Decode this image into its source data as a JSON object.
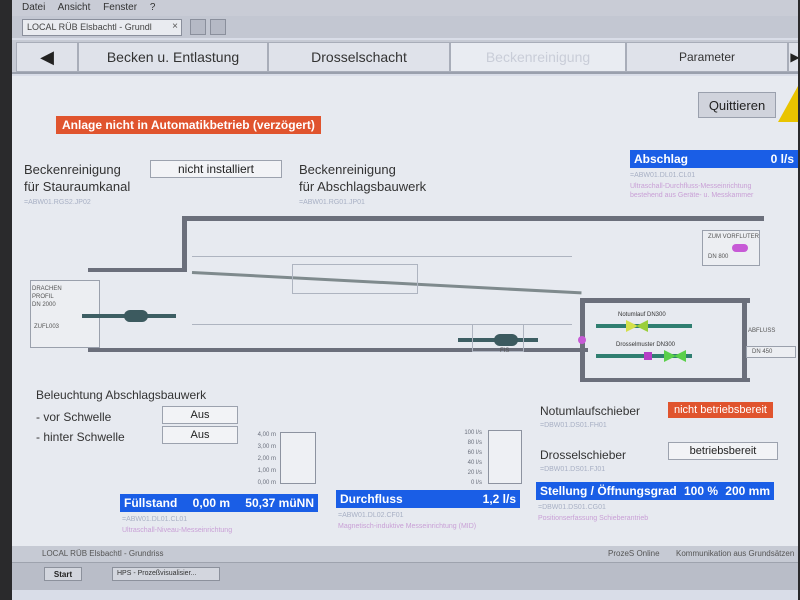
{
  "menu": {
    "items": [
      "Datei",
      "Ansicht",
      "Fenster",
      "?"
    ]
  },
  "document_tab": {
    "label": "LOCAL RÜB Elsbachtl - Grundl",
    "close": "×"
  },
  "nav": {
    "back_arrow": "◀",
    "forward_arrow": "▶",
    "tabs": [
      "Becken u. Entlastung",
      "Drosselschacht",
      "Beckenreinigung",
      "Parameter"
    ],
    "active_tab": "Beckenreinigung"
  },
  "toolbar": {
    "quittieren": "Quittieren"
  },
  "alarm": {
    "automatik": "Anlage nicht in Automatikbetrieb (verzögert)"
  },
  "beckenreinigung_stauraum": {
    "line1": "Beckenreinigung",
    "line2": "für Stauraumkanal",
    "status": "nicht installiert",
    "tag": "=ABW01.RGS2.JP02"
  },
  "beckenreinigung_abschlag": {
    "line1": "Beckenreinigung",
    "line2": "für Abschlagsbauwerk",
    "tag": "=ABW01.RG01.JP01"
  },
  "abschlag": {
    "label": "Abschlag",
    "value": "0 l/s",
    "tag": "=ABW01.DL01.CL01",
    "desc1": "Ultraschall-Durchfluss-Messeinrichtung",
    "desc2": "bestehend aus Geräte- u. Messkammer"
  },
  "diagram": {
    "zum_vorfluter": "ZUM VORFLUTER",
    "dn_vorfluter": "DN 800",
    "ablauf": "ABFLUSS",
    "dn_ablauf": "DN 450",
    "zulauf_line1": "DRACHEN",
    "zulauf_line2": "PROFIL",
    "zulauf_dn": "DN 2000",
    "zulauf_tag": "ZUFL003",
    "notumlauf_small": "Notumlauf DN300",
    "drossel_small": "Drosselmuster DN300",
    "fis": "FIS"
  },
  "beleuchtung": {
    "title": "Beleuchtung Abschlagsbauwerk",
    "vor_label": "- vor Schwelle",
    "vor_value": "Aus",
    "hinter_label": "- hinter Schwelle",
    "hinter_value": "Aus"
  },
  "level_scale": [
    "4,00 m",
    "3,00 m",
    "2,00 m",
    "1,00 m",
    "0,00 m"
  ],
  "flow_scale": [
    "100 l/s",
    "80 l/s",
    "60 l/s",
    "40 l/s",
    "20 l/s",
    "0 l/s"
  ],
  "fuellstand": {
    "label": "Füllstand",
    "value_m": "0,00 m",
    "value_nn": "50,37 müNN",
    "tag": "=ABW01.DL01.CL01",
    "desc": "Ultraschall-Niveau-Messeinrichtung"
  },
  "durchfluss": {
    "label": "Durchfluss",
    "value": "1,2 l/s",
    "tag": "=ABW01.DL02.CF01",
    "desc": "Magnetisch-induktive Messeinrichtung (MID)"
  },
  "notumlauf": {
    "label": "Notumlaufschieber",
    "status": "nicht betriebsbereit",
    "tag": "=DBW01.DS01.FH01"
  },
  "drosselschieber": {
    "label": "Drosselschieber",
    "status": "betriebsbereit",
    "tag": "=DBW01.DS01.FJ01"
  },
  "stellung": {
    "label": "Stellung / Öffnungsgrad",
    "percent": "100 %",
    "mm": "200 mm",
    "tag": "=DBW01.DS01.CG01",
    "desc": "Positionserfassung Schieberantrieb"
  },
  "statusbar": {
    "left": "LOCAL RÜB Elsbachtl - Grundriss",
    "prozess": "ProzeS Online",
    "kommunikation": "Kommunikation aus Grundsätzen"
  },
  "taskbar": {
    "start": "Start",
    "task": "HPS - Prozeßvisualisier..."
  },
  "colors": {
    "alarm": "#e0542e",
    "value_bar": "#1a5ee6",
    "warning": "#e9c400"
  }
}
